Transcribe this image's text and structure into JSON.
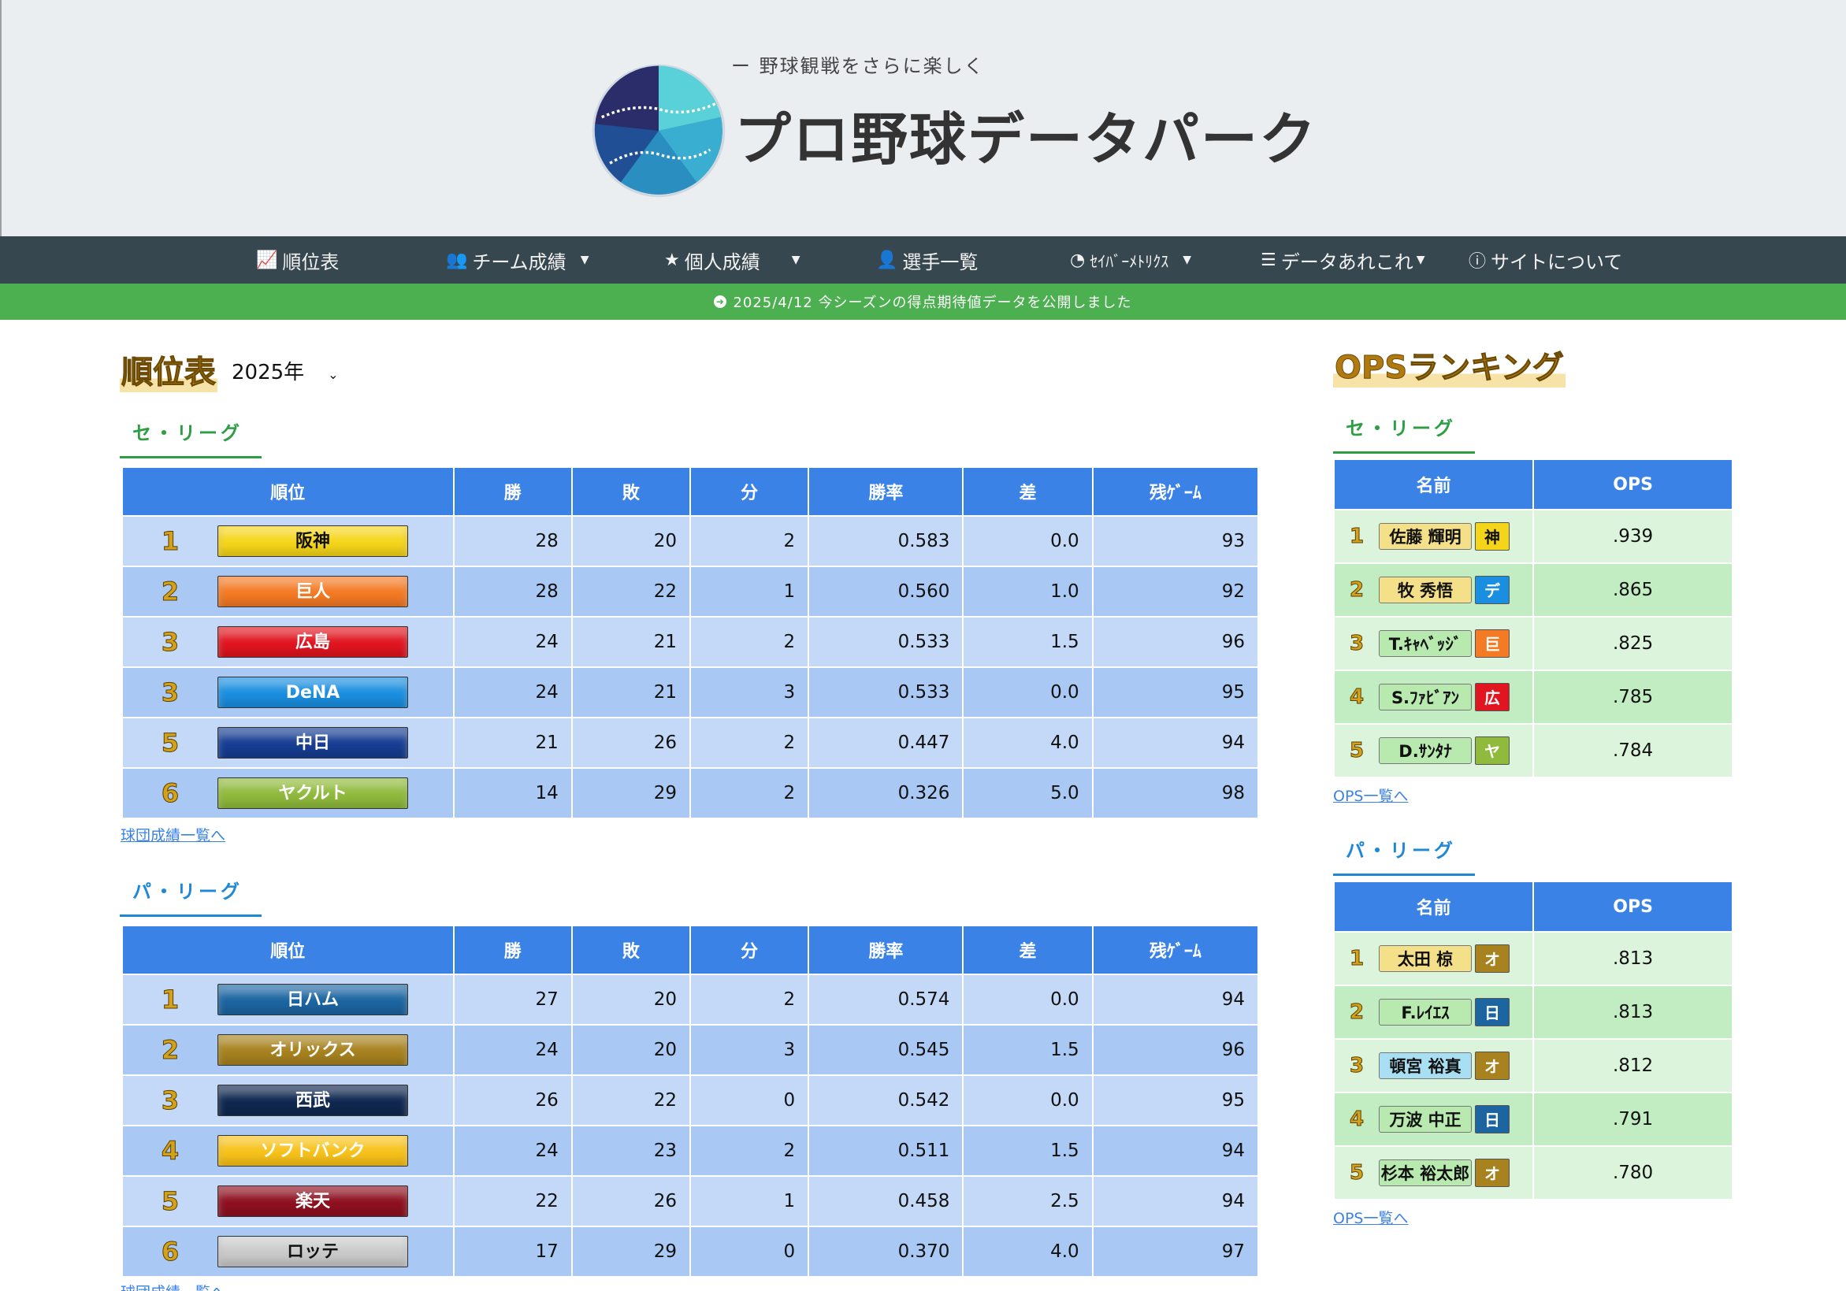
{
  "header": {
    "tagline": "ー 野球観戦をさらに楽しく",
    "site_title": "プロ野球データパーク"
  },
  "nav": [
    {
      "label": "順位表",
      "icon": "chart-line-icon",
      "caret": false
    },
    {
      "label": "チーム成績",
      "icon": "users-icon",
      "caret": true
    },
    {
      "label": "個人成績",
      "icon": "star-icon",
      "caret": true
    },
    {
      "label": "選手一覧",
      "icon": "user-icon",
      "caret": false
    },
    {
      "label": "ｾｲﾊﾞｰﾒﾄﾘｸｽ",
      "icon": "pie-chart-icon",
      "caret": true
    },
    {
      "label": "データあれこれ",
      "icon": "database-icon",
      "caret": true
    },
    {
      "label": "サイトについて",
      "icon": "info-icon",
      "caret": false
    }
  ],
  "notice": {
    "text": "2025/4/12 今シーズンの得点期待値データを公開しました"
  },
  "standings": {
    "title": "順位表",
    "year": "2025年",
    "columns": [
      "順位",
      "勝",
      "敗",
      "分",
      "勝率",
      "差",
      "残ｹﾞｰﾑ"
    ],
    "more_link": "球団成績一覧へ",
    "central": {
      "name": "セ・リーグ",
      "rows": [
        {
          "rank": "1",
          "team": "阪神",
          "color": "#f5d51a",
          "text_color": "#111",
          "w": "28",
          "l": "20",
          "d": "2",
          "pct": "0.583",
          "gb": "0.0",
          "rem": "93"
        },
        {
          "rank": "2",
          "team": "巨人",
          "color": "#f47a24",
          "text_color": "#fff",
          "w": "28",
          "l": "22",
          "d": "1",
          "pct": "0.560",
          "gb": "1.0",
          "rem": "92"
        },
        {
          "rank": "3",
          "team": "広島",
          "color": "#e0151f",
          "text_color": "#fff",
          "w": "24",
          "l": "21",
          "d": "2",
          "pct": "0.533",
          "gb": "1.5",
          "rem": "96"
        },
        {
          "rank": "3",
          "team": "DeNA",
          "color": "#1a8ee0",
          "text_color": "#fff",
          "w": "24",
          "l": "21",
          "d": "3",
          "pct": "0.533",
          "gb": "0.0",
          "rem": "95"
        },
        {
          "rank": "5",
          "team": "中日",
          "color": "#163d92",
          "text_color": "#fff",
          "w": "21",
          "l": "26",
          "d": "2",
          "pct": "0.447",
          "gb": "4.0",
          "rem": "94"
        },
        {
          "rank": "6",
          "team": "ヤクルト",
          "color": "#8fba3c",
          "text_color": "#fff",
          "w": "14",
          "l": "29",
          "d": "2",
          "pct": "0.326",
          "gb": "5.0",
          "rem": "98"
        }
      ]
    },
    "pacific": {
      "name": "パ・リーグ",
      "rows": [
        {
          "rank": "1",
          "team": "日ハム",
          "color": "#1c65a1",
          "text_color": "#fff",
          "w": "27",
          "l": "20",
          "d": "2",
          "pct": "0.574",
          "gb": "0.0",
          "rem": "94"
        },
        {
          "rank": "2",
          "team": "オリックス",
          "color": "#a7821f",
          "text_color": "#fff",
          "w": "24",
          "l": "20",
          "d": "3",
          "pct": "0.545",
          "gb": "1.5",
          "rem": "96"
        },
        {
          "rank": "3",
          "team": "西武",
          "color": "#102850",
          "text_color": "#fff",
          "w": "26",
          "l": "22",
          "d": "0",
          "pct": "0.542",
          "gb": "0.0",
          "rem": "95"
        },
        {
          "rank": "4",
          "team": "ソフトバンク",
          "color": "#f7c21a",
          "text_color": "#fff",
          "w": "24",
          "l": "23",
          "d": "2",
          "pct": "0.511",
          "gb": "1.5",
          "rem": "94"
        },
        {
          "rank": "5",
          "team": "楽天",
          "color": "#8e1020",
          "text_color": "#fff",
          "w": "22",
          "l": "26",
          "d": "1",
          "pct": "0.458",
          "gb": "2.5",
          "rem": "94"
        },
        {
          "rank": "6",
          "team": "ロッテ",
          "color": "#c9c9c9",
          "text_color": "#111",
          "w": "17",
          "l": "29",
          "d": "0",
          "pct": "0.370",
          "gb": "4.0",
          "rem": "97"
        }
      ]
    }
  },
  "ops": {
    "title": "OPSランキング",
    "columns": [
      "名前",
      "OPS"
    ],
    "more_link": "OPS一覧へ",
    "central": {
      "name": "セ・リーグ",
      "rows": [
        {
          "rank": "1",
          "player": "佐藤 輝明",
          "badge_color": "#f5e08a",
          "team_short": "神",
          "team_color": "#f5d51a",
          "team_text": "#111",
          "ops": ".939"
        },
        {
          "rank": "2",
          "player": "牧 秀悟",
          "badge_color": "#f5e08a",
          "team_short": "デ",
          "team_color": "#1a8ee0",
          "team_text": "#fff",
          "ops": ".865"
        },
        {
          "rank": "3",
          "player": "T.ｷｬﾍﾞｯｼﾞ",
          "badge_color": "#b8eab0",
          "team_short": "巨",
          "team_color": "#f47a24",
          "team_text": "#fff",
          "ops": ".825"
        },
        {
          "rank": "4",
          "player": "S.ﾌｧﾋﾞｱﾝ",
          "badge_color": "#b8eab0",
          "team_short": "広",
          "team_color": "#e0151f",
          "team_text": "#fff",
          "ops": ".785"
        },
        {
          "rank": "5",
          "player": "D.ｻﾝﾀﾅ",
          "badge_color": "#b8eab0",
          "team_short": "ヤ",
          "team_color": "#8fba3c",
          "team_text": "#fff",
          "ops": ".784"
        }
      ]
    },
    "pacific": {
      "name": "パ・リーグ",
      "rows": [
        {
          "rank": "1",
          "player": "太田 椋",
          "badge_color": "#f5e08a",
          "team_short": "オ",
          "team_color": "#a7821f",
          "team_text": "#fff",
          "ops": ".813"
        },
        {
          "rank": "2",
          "player": "F.ﾚｲｴｽ",
          "badge_color": "#b8eab0",
          "team_short": "日",
          "team_color": "#1c65a1",
          "team_text": "#fff",
          "ops": ".813"
        },
        {
          "rank": "3",
          "player": "頓宮 裕真",
          "badge_color": "#a8dff2",
          "team_short": "オ",
          "team_color": "#a7821f",
          "team_text": "#fff",
          "ops": ".812"
        },
        {
          "rank": "4",
          "player": "万波 中正",
          "badge_color": "#b8eab0",
          "team_short": "日",
          "team_color": "#1c65a1",
          "team_text": "#fff",
          "ops": ".791"
        },
        {
          "rank": "5",
          "player": "杉本 裕太郎",
          "badge_color": "#b8eab0",
          "team_short": "オ",
          "team_color": "#a7821f",
          "team_text": "#fff",
          "ops": ".780"
        }
      ]
    }
  }
}
